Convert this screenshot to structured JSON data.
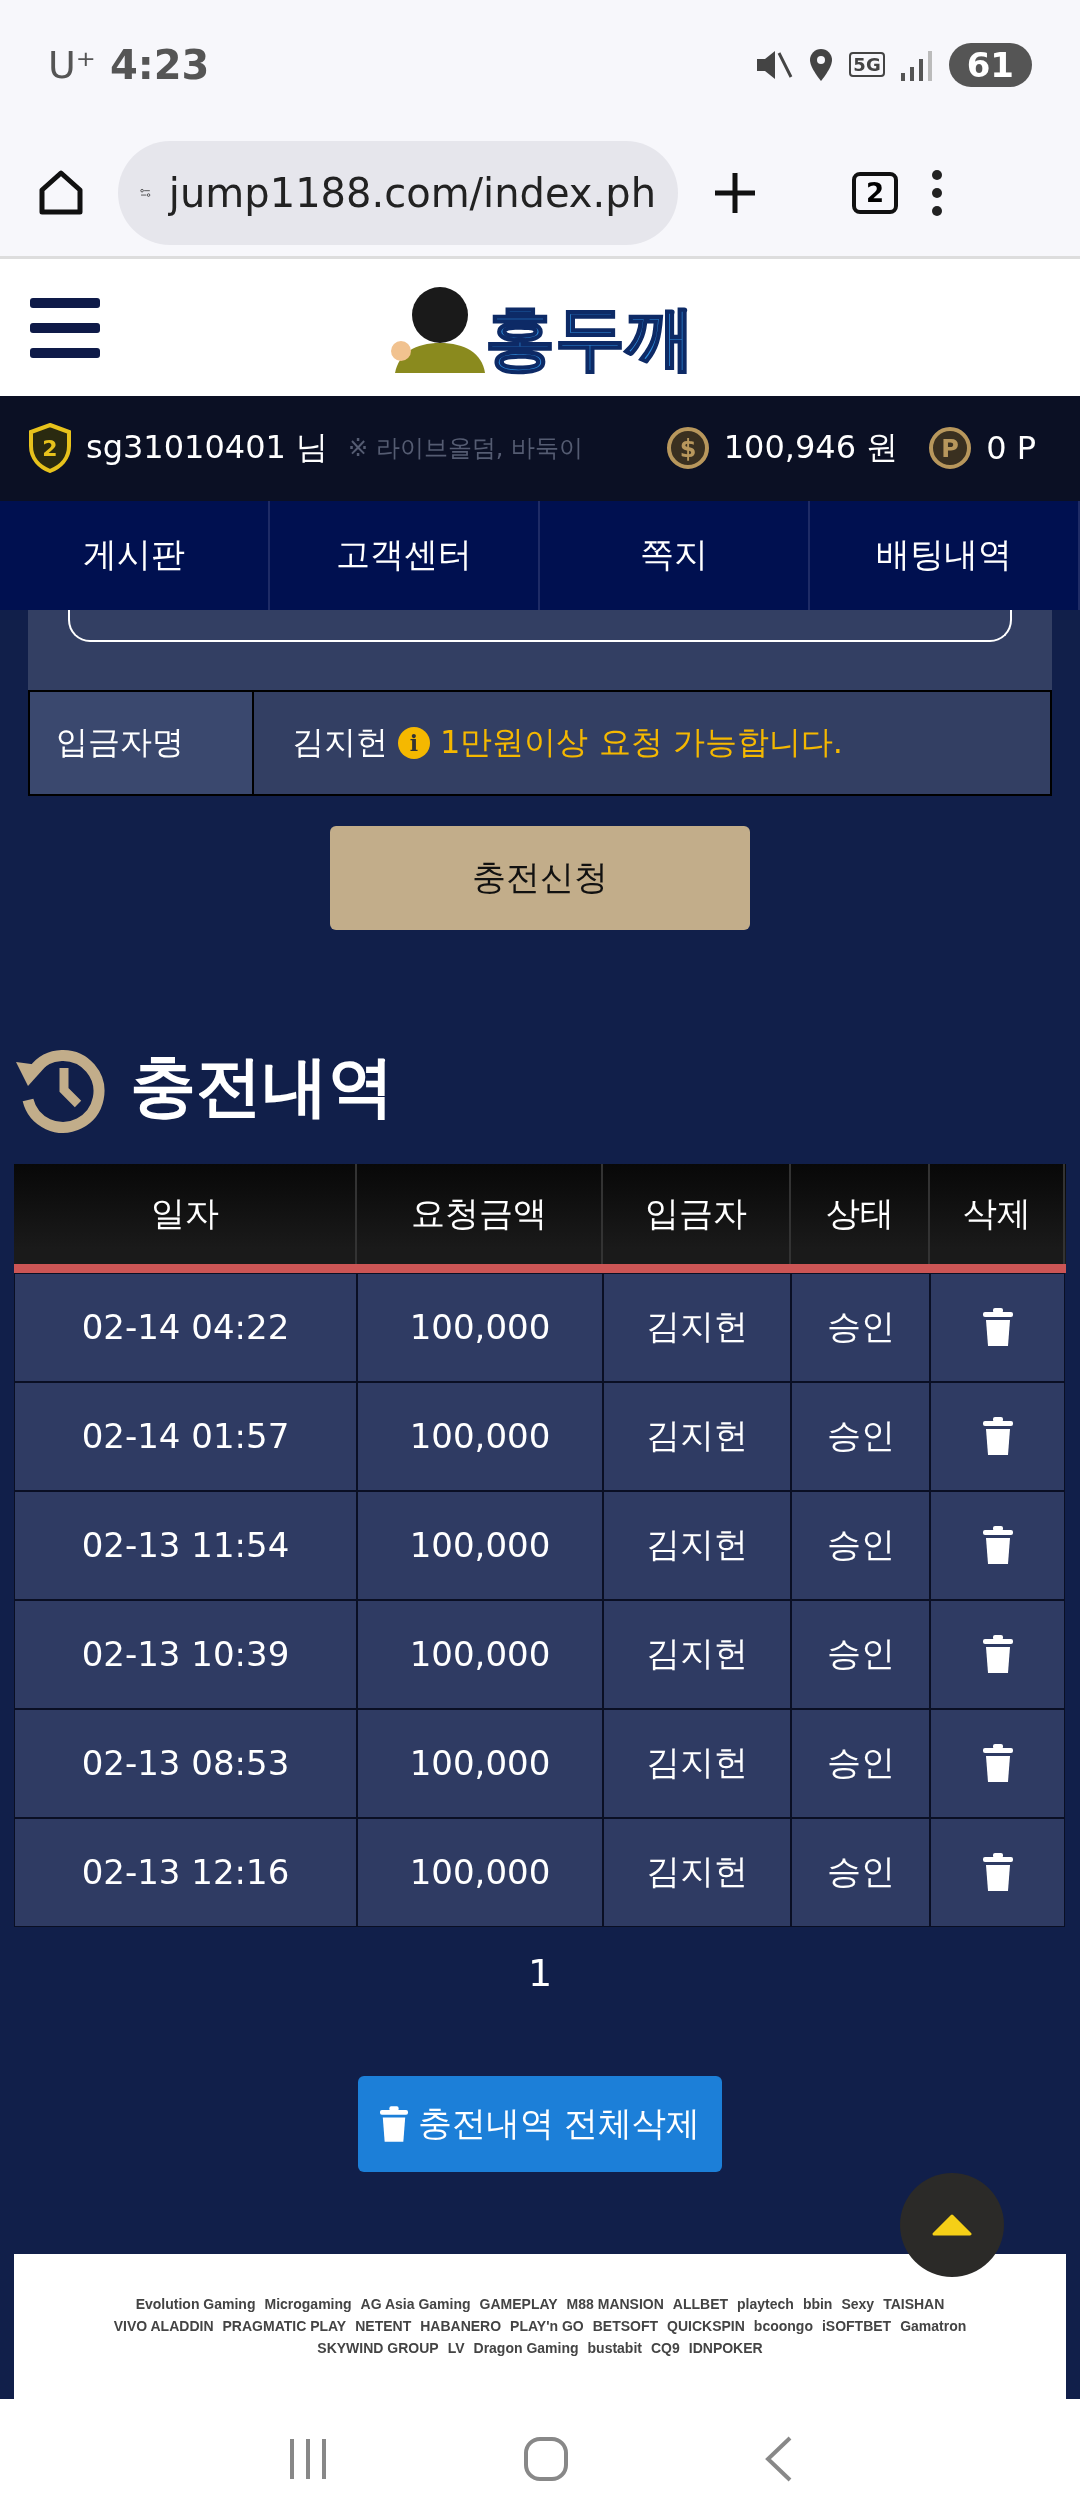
{
  "status_bar": {
    "carrier": "U⁺",
    "time": "4:23",
    "network": "5G",
    "battery": "61"
  },
  "browser": {
    "url": "jump1188.com/index.ph",
    "tab_count": "2"
  },
  "header": {
    "logo_text": "홍두깨"
  },
  "user_bar": {
    "level": "2",
    "username": "sg31010401 님",
    "notice": "※ 라이브올덤, 바둑이",
    "coin_symbol": "$",
    "balance": "100,946 원",
    "point_symbol": "P",
    "points": "0 P"
  },
  "nav_tabs": [
    {
      "label": "게시판"
    },
    {
      "label": "고객센터"
    },
    {
      "label": "쪽지"
    },
    {
      "label": "배팅내역"
    }
  ],
  "deposit_form": {
    "label": "입금자명",
    "depositor": "김지헌",
    "info_icon": "i",
    "note": "1만원이상 요청 가능합니다.",
    "submit": "충전신청"
  },
  "history": {
    "title": "충전내역",
    "columns": [
      "일자",
      "요청금액",
      "입금자",
      "상태",
      "삭제"
    ],
    "rows": [
      {
        "date": "02-14 04:22",
        "amount": "100,000",
        "depositor": "김지헌",
        "status": "승인"
      },
      {
        "date": "02-14 01:57",
        "amount": "100,000",
        "depositor": "김지헌",
        "status": "승인"
      },
      {
        "date": "02-13 11:54",
        "amount": "100,000",
        "depositor": "김지헌",
        "status": "승인"
      },
      {
        "date": "02-13 10:39",
        "amount": "100,000",
        "depositor": "김지헌",
        "status": "승인"
      },
      {
        "date": "02-13 08:53",
        "amount": "100,000",
        "depositor": "김지헌",
        "status": "승인"
      },
      {
        "date": "02-13 12:16",
        "amount": "100,000",
        "depositor": "김지헌",
        "status": "승인"
      }
    ],
    "pages": [
      {
        "label": "1",
        "selected": true
      }
    ],
    "delete_all": "충전내역 전체삭제"
  },
  "providers": [
    [
      "Evolution Gaming",
      "Microgaming",
      "AG Asia Gaming",
      "GAMEPLAY",
      "M88 MANSION",
      "ALLBET",
      "playtech",
      "bbin",
      "Sexy",
      "TAISHAN"
    ],
    [
      "VIVO ALADDIN",
      "PRAGMATIC PLAY",
      "NETENT",
      "HABANERO",
      "PLAY'n GO",
      "BETSOFT",
      "QUICKSPIN",
      "bcoongo",
      "iSOFTBET",
      "Gamatron"
    ],
    [
      "SKYWIND GROUP",
      "LV",
      "Dragon Gaming",
      "bustabit",
      "CQ9",
      "IDNPOKER"
    ]
  ]
}
